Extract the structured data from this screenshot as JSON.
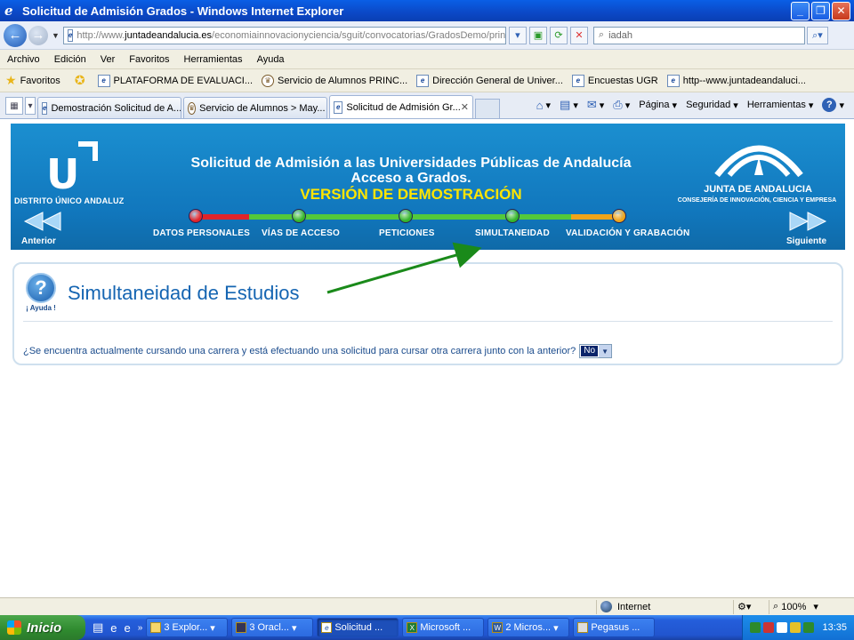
{
  "window": {
    "title": "Solicitud de Admisión Grados - Windows Internet Explorer"
  },
  "address": {
    "url_prefix": "http://www.",
    "url_domain": "juntadeandalucia.es",
    "url_rest": "/economiainnovacionyciencia/sguit/convocatorias/GradosDemo/principal.",
    "search_value": "iadah"
  },
  "menu": [
    "Archivo",
    "Edición",
    "Ver",
    "Favoritos",
    "Herramientas",
    "Ayuda"
  ],
  "favorites": {
    "label": "Favoritos",
    "items": [
      "PLATAFORMA DE EVALUACI...",
      "Servicio de Alumnos  PRINC...",
      "Dirección General de Univer...",
      "Encuestas UGR",
      "http--www.juntadeandaluci..."
    ]
  },
  "tabs": [
    "Demostración Solicitud de A...",
    "Servicio de Alumnos > May...",
    "Solicitud de Admisión Gr..."
  ],
  "commands": {
    "page": "Página",
    "security": "Seguridad",
    "tools": "Herramientas"
  },
  "banner": {
    "distrito": "DISTRITO ÚNICO ANDALUZ",
    "title_line1": "Solicitud de Admisión a las Universidades Públicas de Andalucía",
    "title_line2": "Acceso a Grados.",
    "demo": "VERSIÓN DE DEMOSTRACIÓN",
    "junta": "JUNTA DE ANDALUCIA",
    "consejeria": "CONSEJERÍA DE INNOVACIÓN, CIENCIA Y EMPRESA",
    "prev": "Anterior",
    "next": "Siguiente"
  },
  "steps": [
    {
      "label": "DATOS PERSONALES",
      "color": "#e0242a"
    },
    {
      "label": "VÍAS DE ACCESO",
      "color": "#35b52a"
    },
    {
      "label": "PETICIONES",
      "color": "#35b52a"
    },
    {
      "label": "SIMULTANEIDAD",
      "color": "#35b52a"
    },
    {
      "label": "VALIDACIÓN Y GRABACIÓN",
      "color": "#f0a418"
    }
  ],
  "panel": {
    "help_label": "¡ Ayuda !",
    "title": "Simultaneidad de Estudios",
    "question": "¿Se encuentra actualmente cursando una carrera y está efectuando una solicitud para cursar otra carrera junto con la anterior?",
    "answer": "No"
  },
  "status": {
    "zone": "Internet",
    "zoom": "100%"
  },
  "taskbar": {
    "start": "Inicio",
    "tasks": [
      "3 Explor...",
      "3 Oracl...",
      "Solicitud ...",
      "Microsoft ...",
      "2 Micros...",
      "Pegasus ..."
    ],
    "clock": "13:35"
  },
  "colors": {
    "banner_blue": "#1177bd",
    "title_blue": "#1565b2",
    "demo_yellow": "#ffe500",
    "annotation_green": "#1a8a1a"
  }
}
